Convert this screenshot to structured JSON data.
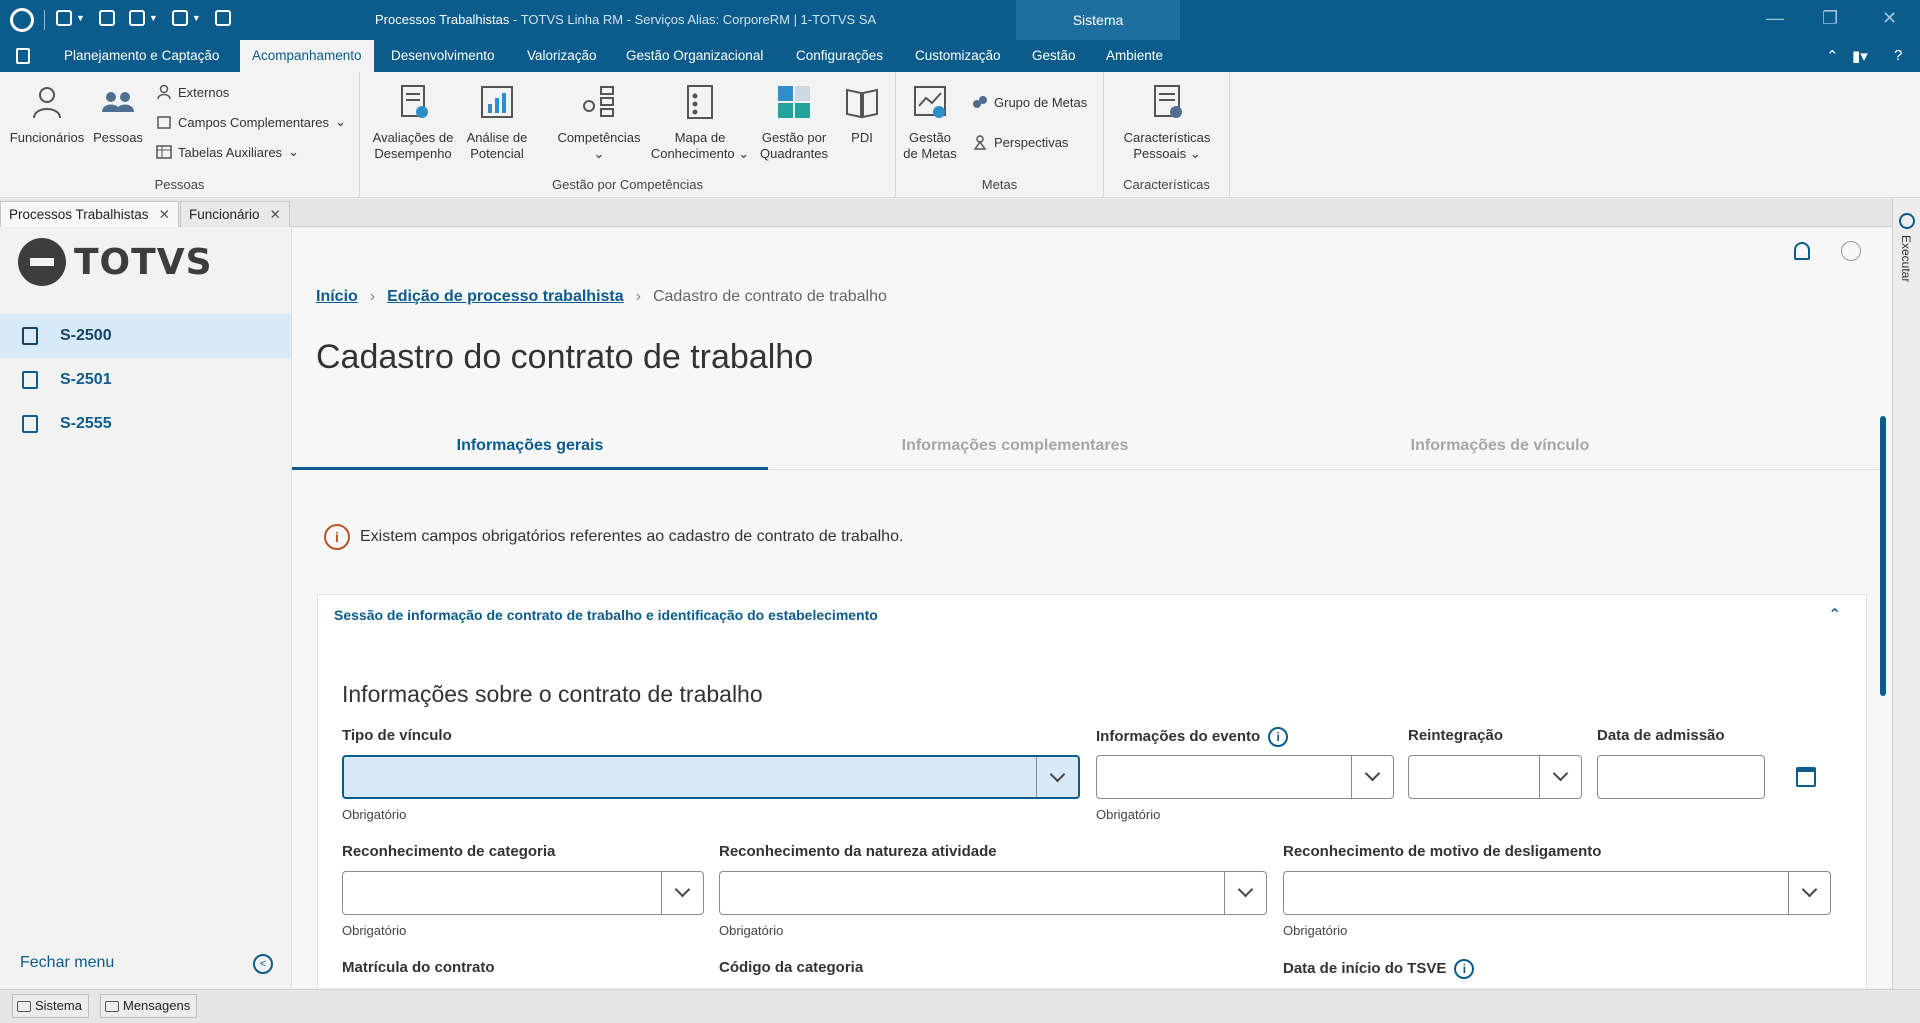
{
  "window": {
    "title": "Processos Trabalhistas",
    "title_rest": " - TOTVS Linha RM - Serviços  Alias: CorporeRM | 1-TOTVS SA",
    "sistema": "Sistema"
  },
  "ribbon_tabs": [
    "Planejamento e Captação",
    "Acompanhamento",
    "Desenvolvimento",
    "Valorização",
    "Gestão Organizacional",
    "Configurações",
    "Customização",
    "Gestão",
    "Ambiente"
  ],
  "ribbon": {
    "funcionarios": "Funcionários",
    "pessoas_btn": "Pessoas",
    "externos": "Externos",
    "campos_complementares": "Campos Complementares",
    "tabelas_auxiliares": "Tabelas Auxiliares",
    "group_pessoas": "Pessoas",
    "avaliacoes_1": "Avaliações de",
    "avaliacoes_2": "Desempenho",
    "analise_1": "Análise de",
    "analise_2": "Potencial",
    "competencias": "Competências",
    "mapa_1": "Mapa de",
    "mapa_2": "Conhecimento",
    "gestao_q_1": "Gestão por",
    "gestao_q_2": "Quadrantes",
    "pdi": "PDI",
    "group_competencias": "Gestão por Competências",
    "gestao_metas_1": "Gestão",
    "gestao_metas_2": "de Metas",
    "grupo_metas": "Grupo de Metas",
    "perspectivas": "Perspectivas",
    "group_metas": "Metas",
    "caract_1": "Características",
    "caract_2": "Pessoais",
    "group_caract": "Características"
  },
  "doc_tabs": [
    "Processos Trabalhistas",
    "Funcionário"
  ],
  "side_strip": "Executar",
  "sidebar": {
    "logo": "TOTVS",
    "items": [
      "S-2500",
      "S-2501",
      "S-2555"
    ],
    "close": "Fechar menu"
  },
  "breadcrumb": {
    "home": "Início",
    "edit": "Edição de processo trabalhista",
    "current": "Cadastro de contrato de trabalho"
  },
  "page_title": "Cadastro do contrato de trabalho",
  "tabs": [
    "Informações gerais",
    "Informações complementares",
    "Informações de vínculo"
  ],
  "alert": "Existem campos obrigatórios referentes ao cadastro de contrato de trabalho.",
  "section": {
    "header": "Sessão de informação de contrato de trabalho e identificação do estabelecimento",
    "title": "Informações sobre o contrato de trabalho"
  },
  "fields": {
    "tipo_vinculo": "Tipo de vínculo",
    "info_evento": "Informações do evento",
    "reintegracao": "Reintegração",
    "data_admissao": "Data de admissão",
    "rec_categoria": "Reconhecimento de categoria",
    "rec_natureza": "Reconhecimento da natureza atividade",
    "rec_motivo": "Reconhecimento de motivo de desligamento",
    "matricula": "Matrícula do contrato",
    "codigo_categoria": "Código da categoria",
    "data_tsve": "Data de início do TSVE",
    "obrigatorio": "Obrigatório"
  },
  "statusbar": [
    "Sistema",
    "Mensagens"
  ]
}
